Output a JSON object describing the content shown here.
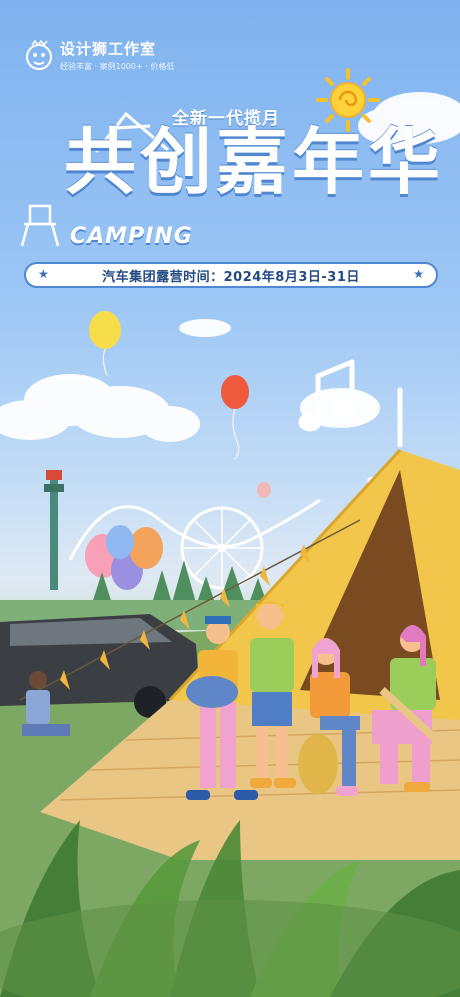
{
  "brand": {
    "name": "设计狮工作室",
    "tagline": "经验丰富 · 案例1000+ · 价格低"
  },
  "headline": {
    "subtitle": "全新一代揽月",
    "title": "共创嘉年华",
    "tag": "CAMPING"
  },
  "event": {
    "date_line": "汽车集团露营时间：2024年8月3日-31日"
  },
  "colors": {
    "sky": "#7fb2ef",
    "tent": "#f2c64a",
    "accent_blue": "#4f87d0",
    "grass": "#6e9a55"
  }
}
